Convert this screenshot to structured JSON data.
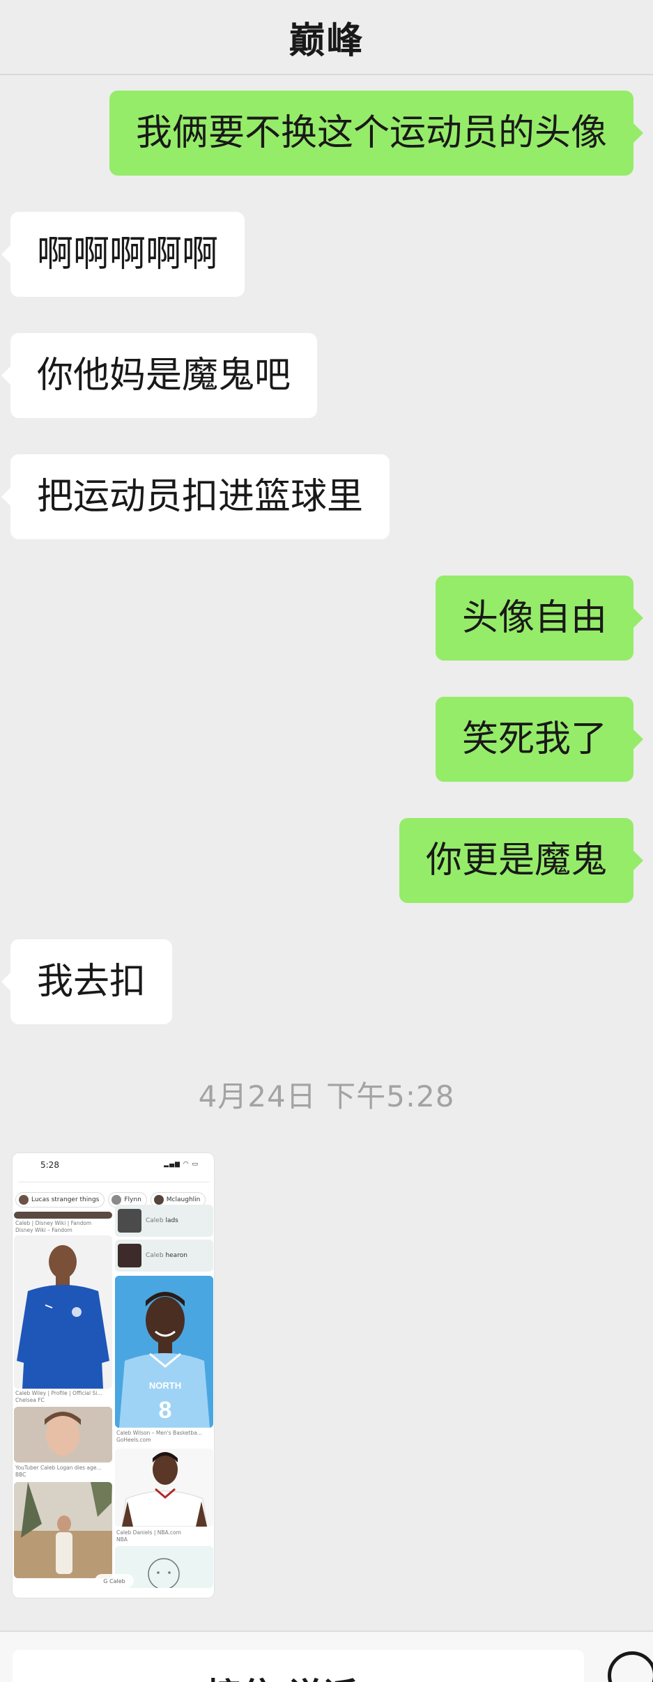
{
  "header": {
    "title": "巅峰"
  },
  "messages": [
    {
      "side": "right",
      "text": "我俩要不换这个运动员的头像"
    },
    {
      "side": "left",
      "text": "啊啊啊啊啊"
    },
    {
      "side": "left",
      "text": "你他妈是魔鬼吧"
    },
    {
      "side": "left",
      "text": "把运动员扣进篮球里"
    },
    {
      "side": "right",
      "text": "头像自由"
    },
    {
      "side": "right",
      "text": "笑死我了"
    },
    {
      "side": "right",
      "text": "你更是魔鬼"
    },
    {
      "side": "left",
      "text": "我去扣"
    }
  ],
  "timestamp": "4月24日 下午5:28",
  "shared_image": {
    "status_time": "5:28",
    "chips": [
      "Lucas stranger things",
      "Flynn",
      "Mclaughlin"
    ],
    "left_column": [
      {
        "caption1": "Caleb | Disney Wiki | Fandom",
        "caption2": "Disney Wiki – Fandom"
      },
      {
        "caption1": "Caleb Wiley | Profile | Official Si...",
        "caption2": "Chelsea FC"
      },
      {
        "caption1": "YouTuber Caleb Logan dies age...",
        "caption2": "BBC"
      }
    ],
    "right_column": [
      {
        "prefix": "Caleb",
        "term": "lads"
      },
      {
        "prefix": "Caleb",
        "term": "hearon"
      }
    ],
    "right_tiles": [
      {
        "caption1": "Caleb Wilson – Men's Basketba...",
        "caption2": "GoHeels.com",
        "jersey_text": "NORTH",
        "jersey_number": "8"
      },
      {
        "caption1": "Caleb Daniels | NBA.com",
        "caption2": "NBA"
      }
    ],
    "bottom_pill": "G Caleb"
  },
  "input_bar": {
    "text": "接住 说话"
  },
  "colors": {
    "sent_bubble": "#95ec69",
    "received_bubble": "#ffffff",
    "background": "#ededed"
  }
}
